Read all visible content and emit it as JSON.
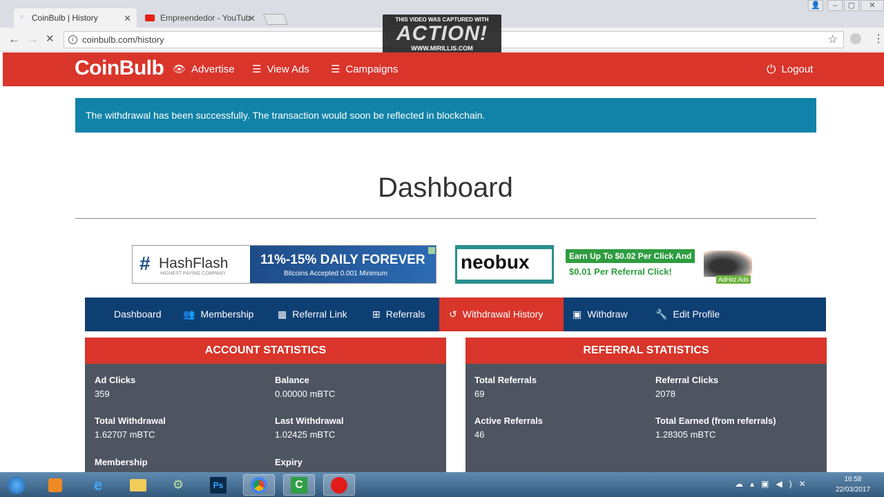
{
  "browser": {
    "tabs": [
      {
        "title": "CoinBulb | History"
      },
      {
        "title": "Empreendedor - YouTub"
      }
    ],
    "url": "coinbulb.com/history"
  },
  "watermark": {
    "line1": "THIS VIDEO WAS CAPTURED WITH",
    "line2": "ACTION!",
    "line3": "WWW.MIRILLIS.COM"
  },
  "site": {
    "logo": "CoinBulb",
    "nav": [
      {
        "label": "Advertise"
      },
      {
        "label": "View Ads"
      },
      {
        "label": "Campaigns"
      }
    ],
    "logout": "Logout"
  },
  "alert": "The withdrawal has been successfully. The transaction would soon be reflected in blockchain.",
  "page_title": "Dashboard",
  "banners": {
    "hashflash_name": "HashFlash",
    "hashflash_tag": "HIGHEST PAYING COMPANY",
    "hashflash_headline": "11%-15% DAILY FOREVER",
    "hashflash_sub": "Bitcoins Accepted 0.001 Minimum",
    "neobux": "neobux",
    "earn_line1": "Earn Up To $0.02 Per Click And",
    "earn_line2": "$0.01 Per Referral Click!",
    "adhitz": "AdHitz Ads"
  },
  "dash_tabs": [
    {
      "label": "Dashboard"
    },
    {
      "label": "Membership"
    },
    {
      "label": "Referral Link"
    },
    {
      "label": "Referrals"
    },
    {
      "label": "Withdrawal History"
    },
    {
      "label": "Withdraw"
    },
    {
      "label": "Edit Profile"
    }
  ],
  "account_stats": {
    "title": "ACCOUNT STATISTICS",
    "items": [
      {
        "label": "Ad Clicks",
        "value": "359"
      },
      {
        "label": "Balance",
        "value": "0.00000 mBTC"
      },
      {
        "label": "Total Withdrawal",
        "value": "1.62707 mBTC"
      },
      {
        "label": "Last Withdrawal",
        "value": "1.02425 mBTC"
      },
      {
        "label": "Membership",
        "value": ""
      },
      {
        "label": "Expiry",
        "value": ""
      }
    ]
  },
  "referral_stats": {
    "title": "REFERRAL STATISTICS",
    "items": [
      {
        "label": "Total Referrals",
        "value": "69"
      },
      {
        "label": "Referral Clicks",
        "value": "2078"
      },
      {
        "label": "Active Referrals",
        "value": "46"
      },
      {
        "label": "Total Earned (from referrals)",
        "value": "1.28305 mBTC"
      }
    ]
  },
  "taskbar": {
    "time": "16:58",
    "date": "22/03/2017"
  },
  "colors": {
    "red": "#d9352b",
    "navy": "#0d3f73",
    "alert": "#1183a8",
    "panel": "#4e5561"
  }
}
